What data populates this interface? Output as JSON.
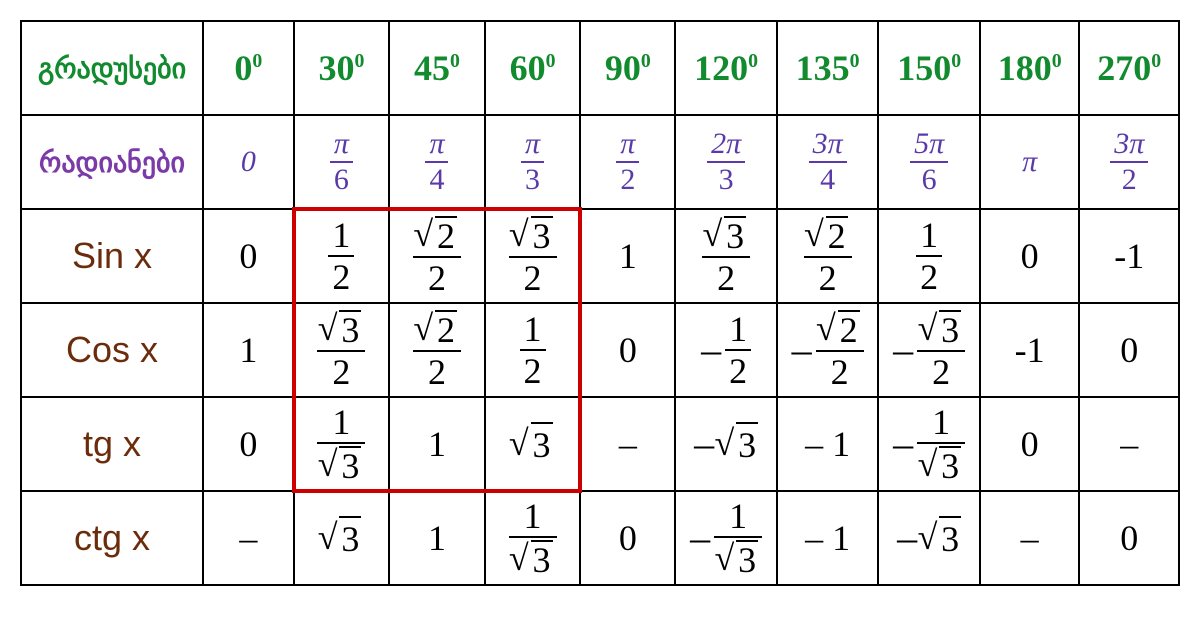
{
  "header": {
    "degrees_label": "გრადუსები",
    "radians_label": "რადიანები",
    "degrees": [
      "0",
      "30",
      "45",
      "60",
      "90",
      "120",
      "135",
      "150",
      "180",
      "270"
    ],
    "radians": [
      {
        "display": "0"
      },
      {
        "num": "π",
        "den": "6"
      },
      {
        "num": "π",
        "den": "4"
      },
      {
        "num": "π",
        "den": "3"
      },
      {
        "num": "π",
        "den": "2"
      },
      {
        "num": "2π",
        "den": "3"
      },
      {
        "num": "3π",
        "den": "4"
      },
      {
        "num": "5π",
        "den": "6"
      },
      {
        "display": "π"
      },
      {
        "num": "3π",
        "den": "2"
      }
    ]
  },
  "rows": {
    "sin": {
      "label": "Sin x",
      "v": [
        {
          "t": "plain",
          "v": "0"
        },
        {
          "t": "frac",
          "n": "1",
          "d": "2"
        },
        {
          "t": "frac",
          "n": "√2",
          "d": "2",
          "sqn": true
        },
        {
          "t": "frac",
          "n": "√3",
          "d": "2",
          "sqn": true
        },
        {
          "t": "plain",
          "v": "1"
        },
        {
          "t": "frac",
          "n": "√3",
          "d": "2",
          "sqn": true
        },
        {
          "t": "frac",
          "n": "√2",
          "d": "2",
          "sqn": true
        },
        {
          "t": "frac",
          "n": "1",
          "d": "2"
        },
        {
          "t": "plain",
          "v": "0"
        },
        {
          "t": "plain",
          "v": "-1"
        }
      ]
    },
    "cos": {
      "label": "Cos x",
      "v": [
        {
          "t": "plain",
          "v": "1"
        },
        {
          "t": "frac",
          "n": "√3",
          "d": "2",
          "sqn": true
        },
        {
          "t": "frac",
          "n": "√2",
          "d": "2",
          "sqn": true
        },
        {
          "t": "frac",
          "n": "1",
          "d": "2"
        },
        {
          "t": "plain",
          "v": "0"
        },
        {
          "t": "frac",
          "n": "1",
          "d": "2",
          "neg": true
        },
        {
          "t": "frac",
          "n": "√2",
          "d": "2",
          "sqn": true,
          "neg": true
        },
        {
          "t": "frac",
          "n": "√3",
          "d": "2",
          "sqn": true,
          "neg": true
        },
        {
          "t": "plain",
          "v": "-1"
        },
        {
          "t": "plain",
          "v": "0"
        }
      ]
    },
    "tg": {
      "label": "tg x",
      "v": [
        {
          "t": "plain",
          "v": "0"
        },
        {
          "t": "frac",
          "n": "1",
          "d": "√3",
          "sqd": true
        },
        {
          "t": "plain",
          "v": "1"
        },
        {
          "t": "sqrt",
          "r": "3"
        },
        {
          "t": "plain",
          "v": "–"
        },
        {
          "t": "sqrt",
          "r": "3",
          "neg": true
        },
        {
          "t": "plain",
          "v": "– 1"
        },
        {
          "t": "frac",
          "n": "1",
          "d": "√3",
          "sqd": true,
          "neg": true
        },
        {
          "t": "plain",
          "v": "0"
        },
        {
          "t": "plain",
          "v": "–"
        }
      ]
    },
    "ctg": {
      "label": "ctg x",
      "v": [
        {
          "t": "plain",
          "v": "–"
        },
        {
          "t": "sqrt",
          "r": "3"
        },
        {
          "t": "plain",
          "v": "1"
        },
        {
          "t": "frac",
          "n": "1",
          "d": "√3",
          "sqd": true
        },
        {
          "t": "plain",
          "v": "0"
        },
        {
          "t": "frac",
          "n": "1",
          "d": "√3",
          "sqd": true,
          "neg": true
        },
        {
          "t": "plain",
          "v": "– 1"
        },
        {
          "t": "sqrt",
          "r": "3",
          "neg": true
        },
        {
          "t": "plain",
          "v": "–"
        },
        {
          "t": "plain",
          "v": "0"
        }
      ]
    }
  },
  "chart_data": {
    "type": "table",
    "title": "Trigonometric function values at common angles",
    "columns_deg": [
      0,
      30,
      45,
      60,
      90,
      120,
      135,
      150,
      180,
      270
    ],
    "columns_rad": [
      "0",
      "π/6",
      "π/4",
      "π/3",
      "π/2",
      "2π/3",
      "3π/4",
      "5π/6",
      "π",
      "3π/2"
    ],
    "sin": [
      "0",
      "1/2",
      "√2/2",
      "√3/2",
      "1",
      "√3/2",
      "√2/2",
      "1/2",
      "0",
      "-1"
    ],
    "cos": [
      "1",
      "√3/2",
      "√2/2",
      "1/2",
      "0",
      "-1/2",
      "-√2/2",
      "-√3/2",
      "-1",
      "0"
    ],
    "tg": [
      "0",
      "1/√3",
      "1",
      "√3",
      "undef",
      "-√3",
      "-1",
      "-1/√3",
      "0",
      "undef"
    ],
    "ctg": [
      "undef",
      "√3",
      "1",
      "1/√3",
      "0",
      "-1/√3",
      "-1",
      "-√3",
      "undef",
      "0"
    ],
    "highlight_cols_deg": [
      30,
      45,
      60
    ],
    "highlight_rows": [
      "sin",
      "cos",
      "tg"
    ]
  }
}
